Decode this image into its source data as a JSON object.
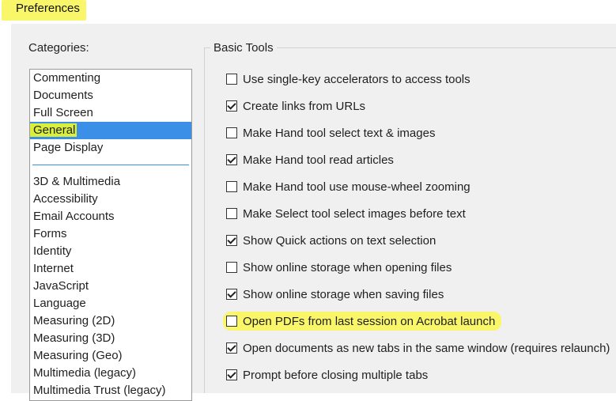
{
  "window": {
    "title": "Preferences"
  },
  "categories": {
    "label": "Categories:",
    "group1": [
      "Commenting",
      "Documents",
      "Full Screen",
      "General",
      "Page Display"
    ],
    "group2": [
      "3D & Multimedia",
      "Accessibility",
      "Email Accounts",
      "Forms",
      "Identity",
      "Internet",
      "JavaScript",
      "Language",
      "Measuring (2D)",
      "Measuring (3D)",
      "Measuring (Geo)",
      "Multimedia (legacy)",
      "Multimedia Trust (legacy)"
    ],
    "selected": "General"
  },
  "basic_tools": {
    "label": "Basic Tools",
    "options": [
      {
        "label": "Use single-key accelerators to access tools",
        "checked": false
      },
      {
        "label": "Create links from URLs",
        "checked": true
      },
      {
        "label": "Make Hand tool select text & images",
        "checked": false
      },
      {
        "label": "Make Hand tool read articles",
        "checked": true
      },
      {
        "label": "Make Hand tool use mouse-wheel zooming",
        "checked": false
      },
      {
        "label": "Make Select tool select images before text",
        "checked": false
      },
      {
        "label": "Show Quick actions on text selection",
        "checked": true
      },
      {
        "label": "Show online storage when opening files",
        "checked": false
      },
      {
        "label": "Show online storage when saving files",
        "checked": true
      },
      {
        "label": "Open PDFs from last session on Acrobat launch",
        "checked": false,
        "highlighted": true
      },
      {
        "label": "Open documents as new tabs in the same window (requires relaunch)",
        "checked": true
      },
      {
        "label": "Prompt before closing multiple tabs",
        "checked": true
      }
    ]
  },
  "colors": {
    "selection": "#3b8fe6",
    "highlight": "#f9f66a"
  }
}
